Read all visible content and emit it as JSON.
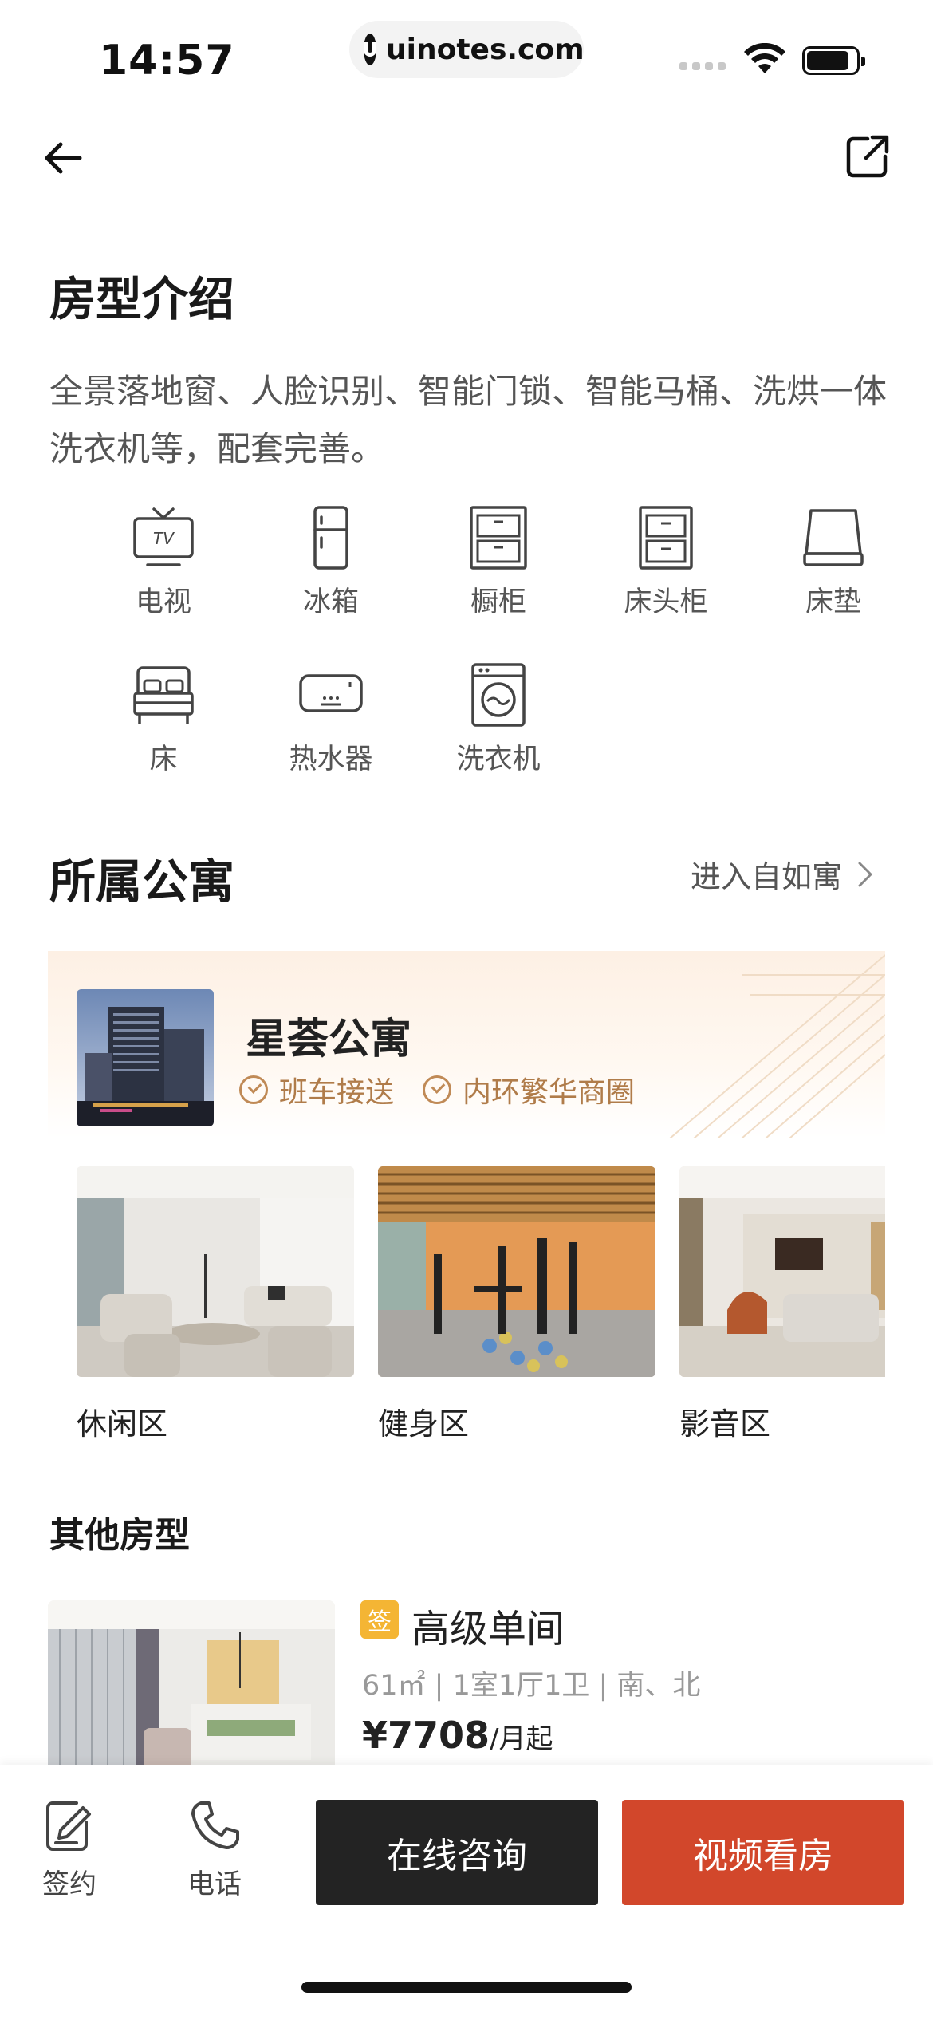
{
  "status_bar": {
    "time": "14:57",
    "url": "uinotes.com"
  },
  "room_intro": {
    "title": "房型介绍",
    "description": "全景落地窗、人脸识别、智能门锁、智能马桶、洗烘一体洗衣机等，配套完善。",
    "amenities": [
      {
        "label": "电视",
        "icon": "tv-icon"
      },
      {
        "label": "冰箱",
        "icon": "fridge-icon"
      },
      {
        "label": "橱柜",
        "icon": "cabinet-icon"
      },
      {
        "label": "床头柜",
        "icon": "nightstand-icon"
      },
      {
        "label": "床垫",
        "icon": "mattress-icon"
      },
      {
        "label": "床",
        "icon": "bed-icon"
      },
      {
        "label": "热水器",
        "icon": "water-heater-icon"
      },
      {
        "label": "洗衣机",
        "icon": "washing-machine-icon"
      }
    ]
  },
  "apartment": {
    "section_title": "所属公寓",
    "enter_link": "进入自如寓",
    "name": "星荟公寓",
    "tags": [
      "班车接送",
      "内环繁华商圈"
    ],
    "facilities": [
      {
        "label": "休闲区"
      },
      {
        "label": "健身区"
      },
      {
        "label": "影音区"
      }
    ]
  },
  "other_rooms": {
    "title": "其他房型",
    "items": [
      {
        "badge": "签",
        "name": "高级单间",
        "meta": "61㎡ | 1室1厅1卫 | 南、北",
        "price": "¥7708",
        "price_unit": "/月起"
      }
    ]
  },
  "bottom_bar": {
    "sign_label": "签约",
    "phone_label": "电话",
    "consult_label": "在线咨询",
    "video_label": "视频看房"
  },
  "colors": {
    "accent": "#d2472b",
    "dark_button": "#232323",
    "tag_gold": "#b07c4a",
    "badge_yellow": "#f4b534"
  }
}
